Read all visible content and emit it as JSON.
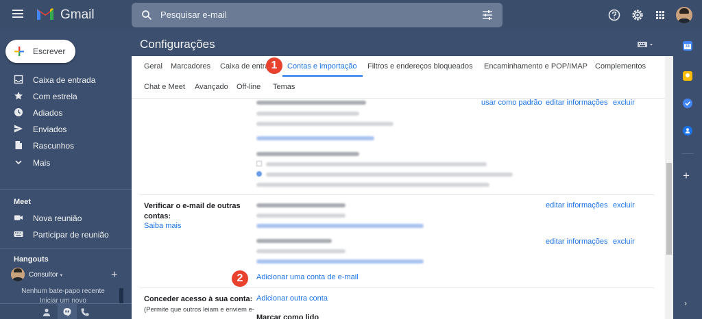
{
  "app": {
    "brand": "Gmail",
    "search_placeholder": "Pesquisar e-mail"
  },
  "sidebar": {
    "compose_label": "Escrever",
    "items": [
      {
        "label": "Caixa de entrada",
        "icon": "inbox-icon"
      },
      {
        "label": "Com estrela",
        "icon": "star-icon"
      },
      {
        "label": "Adiados",
        "icon": "clock-icon"
      },
      {
        "label": "Enviados",
        "icon": "send-icon"
      },
      {
        "label": "Rascunhos",
        "icon": "draft-icon"
      },
      {
        "label": "Mais",
        "icon": "chevron-down-icon"
      }
    ],
    "meet": {
      "title": "Meet",
      "items": [
        {
          "label": "Nova reunião",
          "icon": "video-icon"
        },
        {
          "label": "Participar de reunião",
          "icon": "keyboard-icon"
        }
      ]
    },
    "hangouts": {
      "title": "Hangouts",
      "user": "Consultor",
      "no_chats": "Nenhum bate-papo recente",
      "start_new": "Iniciar um novo"
    }
  },
  "main": {
    "title": "Configurações",
    "tabs": [
      {
        "label": "Geral"
      },
      {
        "label": "Marcadores"
      },
      {
        "label": "Caixa de entrada"
      },
      {
        "label": "Contas e importação",
        "active": true
      },
      {
        "label": "Filtros e endereços bloqueados"
      },
      {
        "label": "Encaminhamento e POP/IMAP"
      },
      {
        "label": "Complementos"
      },
      {
        "label": "Chat e Meet"
      },
      {
        "label": "Avançado"
      },
      {
        "label": "Off-line"
      },
      {
        "label": "Temas"
      }
    ],
    "send_as": {
      "use_default": "usar como padrão",
      "edit_info": "editar informações",
      "delete": "excluir"
    },
    "check_mail": {
      "label": "Verificar o e-mail de outras contas:",
      "learn_more": "Saiba mais",
      "edit_info_1": "editar informações",
      "delete_1": "excluir",
      "edit_info_2": "editar informações",
      "delete_2": "excluir",
      "add_account": "Adicionar uma conta de e-mail"
    },
    "grant_access": {
      "label": "Conceder acesso à sua conta:",
      "desc": "(Permite que outros leiam e enviem e-",
      "add_other": "Adicionar outra conta",
      "mark_read": "Marcar como lido"
    }
  },
  "markers": [
    "1",
    "2"
  ],
  "colors": {
    "accent": "#1a73e8",
    "marker": "#e8412e",
    "dark_theme": "#3c4f6e"
  }
}
